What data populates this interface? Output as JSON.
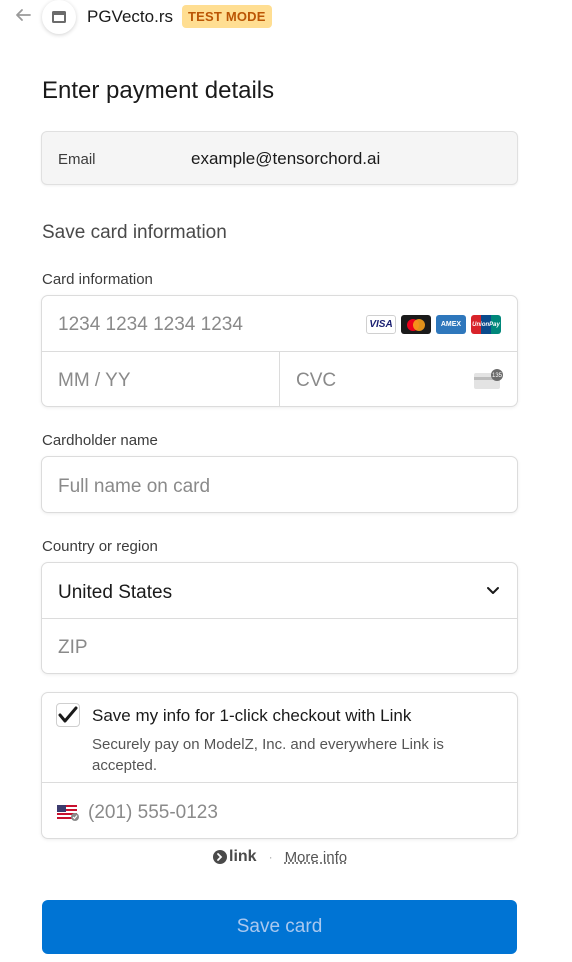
{
  "header": {
    "merchant_name": "PGVecto.rs",
    "test_badge": "TEST MODE"
  },
  "page_title": "Enter payment details",
  "email": {
    "label": "Email",
    "value": "example@tensorchord.ai"
  },
  "section_title": "Save card information",
  "card": {
    "label": "Card information",
    "number_placeholder": "1234 1234 1234 1234",
    "expiry_placeholder": "MM / YY",
    "cvc_placeholder": "CVC",
    "brands": [
      "visa-icon",
      "mastercard-icon",
      "amex-icon",
      "unionpay-icon"
    ],
    "brand_labels": {
      "visa": "VISA",
      "amex": "AMEX",
      "unionpay": "UnionPay"
    },
    "cvc_icon_text": "135"
  },
  "cardholder": {
    "label": "Cardholder name",
    "placeholder": "Full name on card"
  },
  "country": {
    "label": "Country or region",
    "selected": "United States",
    "zip_placeholder": "ZIP"
  },
  "link": {
    "checkbox_checked": true,
    "title": "Save my info for 1-click checkout with Link",
    "description": "Securely pay on ModelZ, Inc. and everywhere Link is accepted.",
    "phone_placeholder": "(201) 555-0123",
    "logo_text": "link",
    "separator": "·",
    "more_info": "More info"
  },
  "submit": {
    "label": "Save card"
  },
  "colors": {
    "primary_button": "#0074d4",
    "test_badge_bg": "#ffde92",
    "test_badge_text": "#bb5504"
  }
}
